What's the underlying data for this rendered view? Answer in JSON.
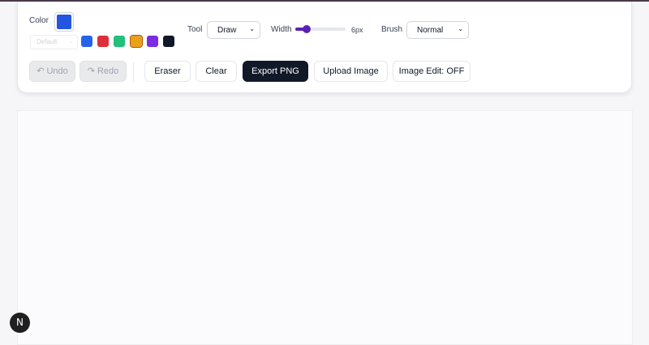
{
  "toolbar": {
    "color_label": "Color",
    "current_color": "#2355e0",
    "preset_select": {
      "value": "Default"
    },
    "swatches": [
      {
        "name": "blue",
        "color": "#2563eb"
      },
      {
        "name": "red",
        "color": "#dc2f3c"
      },
      {
        "name": "green",
        "color": "#22c07a"
      },
      {
        "name": "orange",
        "color": "#e8a218",
        "selected": true
      },
      {
        "name": "purple",
        "color": "#7b2be0"
      },
      {
        "name": "black",
        "color": "#111827"
      }
    ],
    "tool": {
      "label": "Tool",
      "value": "Draw"
    },
    "width": {
      "label": "Width",
      "value": "6px",
      "fraction": 0.2
    },
    "brush": {
      "label": "Brush",
      "value": "Normal"
    },
    "undo_label": "↶ Undo",
    "redo_label": "↷ Redo",
    "eraser_label": "Eraser",
    "clear_label": "Clear",
    "export_label": "Export PNG",
    "upload_label": "Upload Image",
    "image_edit_label": "Image Edit: OFF"
  },
  "badge": {
    "letter": "N"
  }
}
